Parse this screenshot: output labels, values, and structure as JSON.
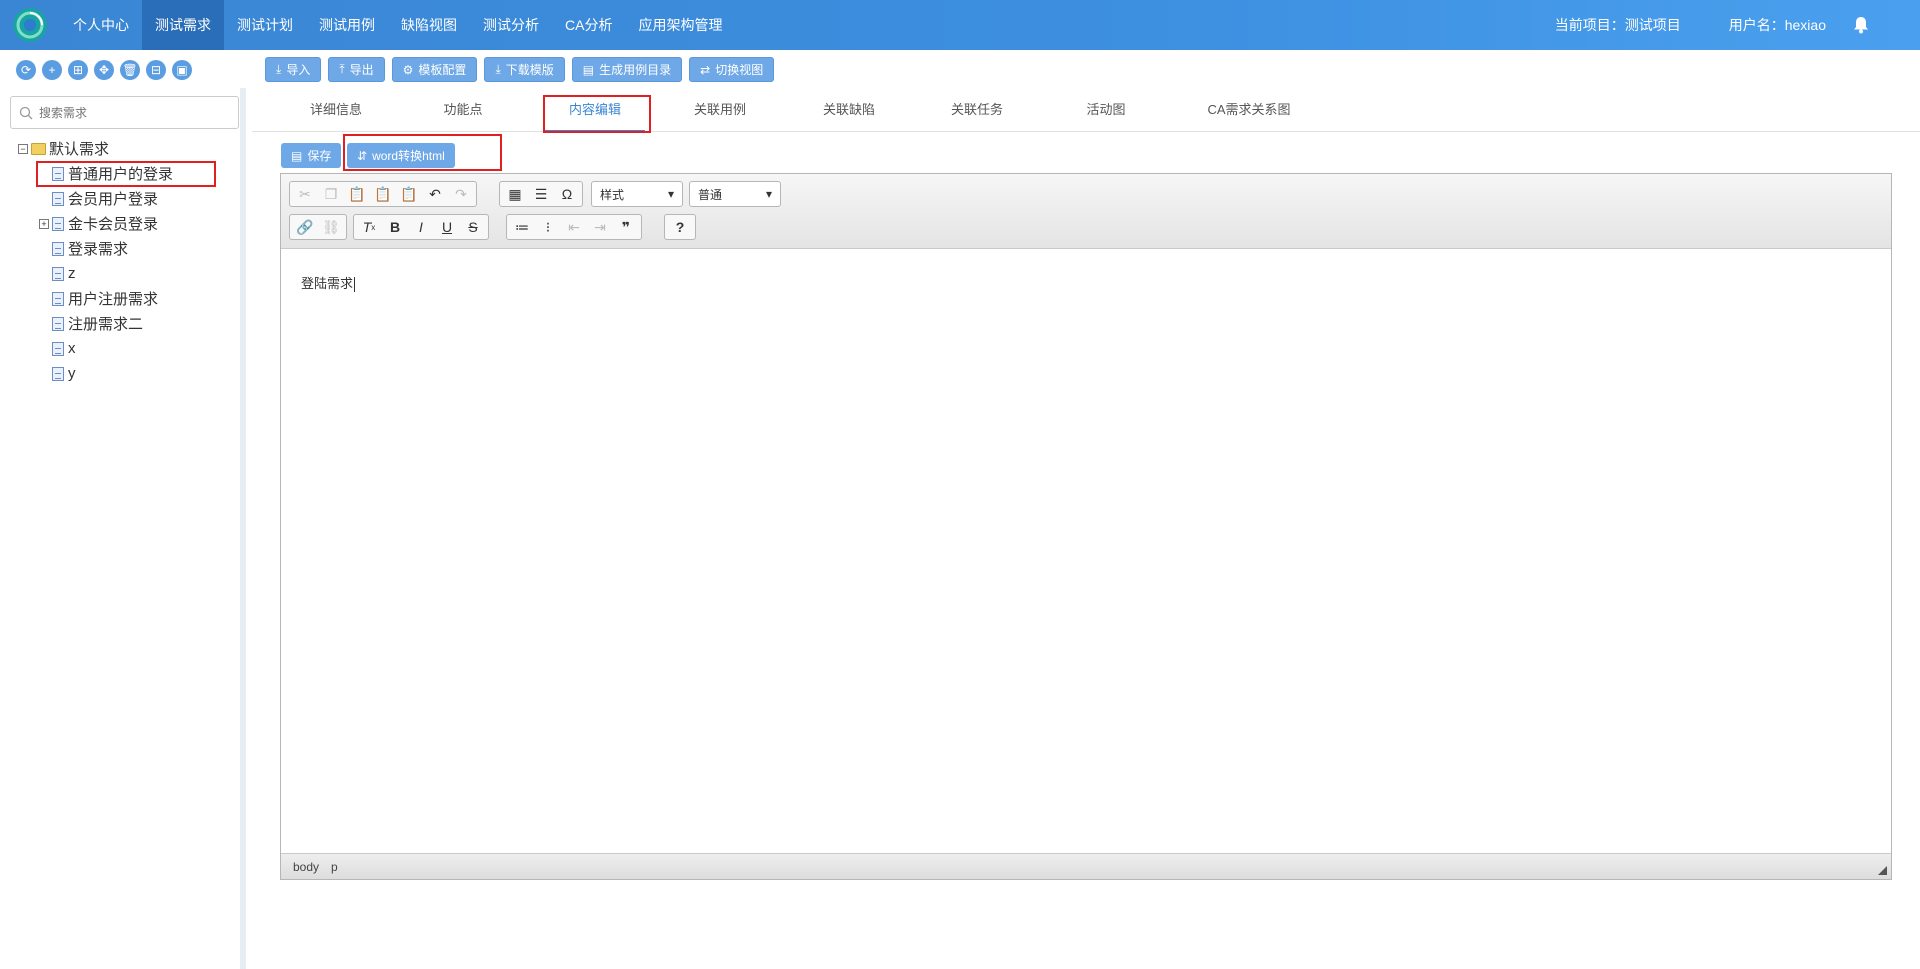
{
  "nav": {
    "items": [
      "个人中心",
      "测试需求",
      "测试计划",
      "测试用例",
      "缺陷视图",
      "测试分析",
      "CA分析",
      "应用架构管理"
    ],
    "active_index": 1,
    "project_label": "当前项目：测试项目",
    "user_label": "用户名：hexiao"
  },
  "toolbar": {
    "left_icons": [
      "refresh-icon",
      "add-icon",
      "expand-all-icon",
      "move-icon",
      "delete-icon",
      "collapse-icon",
      "export-view-icon"
    ],
    "actions": [
      "导入",
      "导出",
      "模板配置",
      "下载模版",
      "生成用例目录",
      "切换视图"
    ]
  },
  "sidebar": {
    "search_placeholder": "搜索需求",
    "root": "默认需求",
    "items": [
      "普通用户的登录",
      "会员用户登录",
      "金卡会员登录",
      "登录需求",
      "z",
      "用户注册需求",
      "注册需求二",
      "x",
      "y"
    ]
  },
  "tabs": [
    "详细信息",
    "功能点",
    "内容编辑",
    "关联用例",
    "关联缺陷",
    "关联任务",
    "活动图",
    "CA需求关系图"
  ],
  "active_tab": 2,
  "editor": {
    "save_label": "保存",
    "word_label": "word转换html",
    "style_combo": "样式",
    "format_combo": "普通",
    "content": "登陆需求",
    "status_path": [
      "body",
      "p"
    ]
  },
  "colors": {
    "nav_bg": "#3d8fe0",
    "nav_active": "#2a6db8",
    "button_bg": "#6fa8e6",
    "highlight": "#e02020"
  }
}
